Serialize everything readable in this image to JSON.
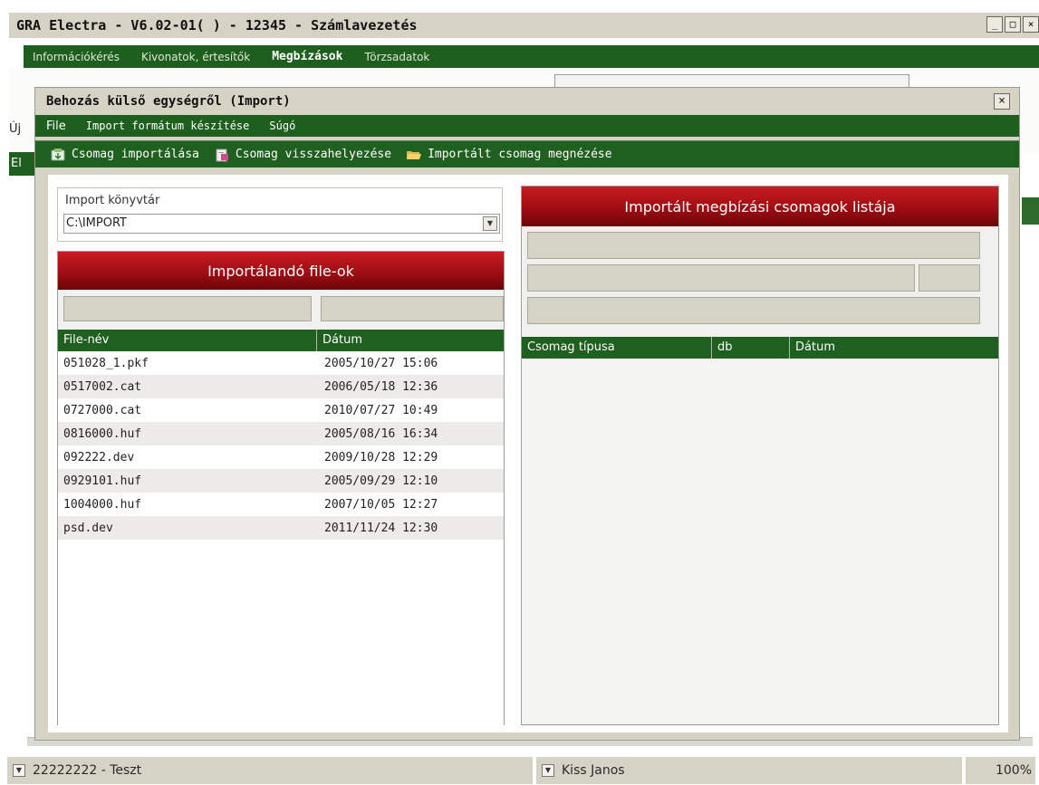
{
  "main_window": {
    "title": "GRA Electra - V6.02-01( ) - 12345 - Számlavezetés",
    "menu": [
      "Információkérés",
      "Kivonatok, értesítők",
      "Megbízások",
      "Törzsadatok"
    ],
    "active_menu": "Megbízások",
    "bg_text_uj": "Új",
    "bg_text_el": "El"
  },
  "dialog": {
    "title": "Behozás külső egységről (Import)",
    "menu": {
      "file": "File",
      "import_format": "Import formátum készítése",
      "help": "Súgó"
    },
    "toolbar": {
      "import_package": "Csomag importálása",
      "restore_package": "Csomag visszahelyezése",
      "view_imported": "Importált csomag megnézése"
    },
    "import_dir": {
      "label": "Import könyvtár",
      "value": "C:\\IMPORT"
    },
    "files_panel": {
      "title": "Importálandó file-ok",
      "columns": [
        "File-név",
        "Dátum"
      ],
      "rows": [
        {
          "name": "051028_1.pkf",
          "date": "2005/10/27 15:06"
        },
        {
          "name": "0517002.cat",
          "date": "2006/05/18 12:36"
        },
        {
          "name": "0727000.cat",
          "date": "2010/07/27 10:49"
        },
        {
          "name": "0816000.huf",
          "date": "2005/08/16 16:34"
        },
        {
          "name": "092222.dev",
          "date": "2009/10/28 12:29"
        },
        {
          "name": "0929101.huf",
          "date": "2005/09/29 12:10"
        },
        {
          "name": "1004000.huf",
          "date": "2007/10/05 12:27"
        },
        {
          "name": "psd.dev",
          "date": "2011/11/24 12:30"
        }
      ]
    },
    "packages_panel": {
      "title": "Importált megbízási csomagok listája",
      "columns": [
        "Csomag típusa",
        "db",
        "Dátum"
      ]
    }
  },
  "status_bar": {
    "account": "22222222 - Teszt",
    "user": "Kiss Janos",
    "zoom": "100%"
  },
  "colors": {
    "menu_green": "#1e5e1e",
    "header_red": "#9a0c12",
    "panel_beige": "#d6d3c4"
  }
}
